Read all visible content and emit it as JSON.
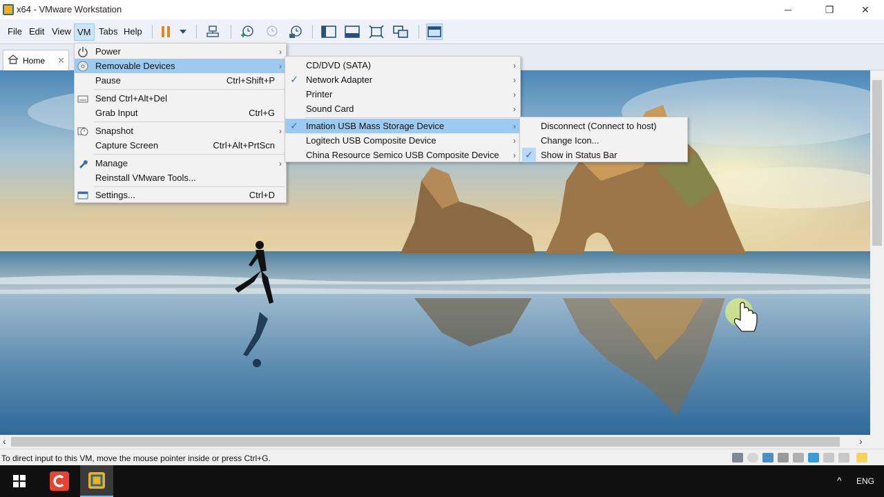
{
  "window": {
    "title": "x64 - VMware Workstation",
    "minimize": "─",
    "maximize": "❐",
    "close": "✕"
  },
  "menubar": {
    "items": [
      "File",
      "Edit",
      "View",
      "VM",
      "Tabs",
      "Help"
    ]
  },
  "tabs": {
    "home_label": "Home",
    "home_close": "✕"
  },
  "vm_menu": {
    "power": "Power",
    "removable": "Removable Devices",
    "pause": "Pause",
    "pause_shortcut": "Ctrl+Shift+P",
    "send_cad": "Send Ctrl+Alt+Del",
    "grab_input": "Grab Input",
    "grab_shortcut": "Ctrl+G",
    "snapshot": "Snapshot",
    "capture": "Capture Screen",
    "capture_shortcut": "Ctrl+Alt+PrtScn",
    "manage": "Manage",
    "reinstall": "Reinstall VMware Tools...",
    "settings": "Settings...",
    "settings_shortcut": "Ctrl+D"
  },
  "removable_menu": {
    "cd": "CD/DVD (SATA)",
    "network": "Network Adapter",
    "printer": "Printer",
    "sound": "Sound Card",
    "imation": "Imation USB Mass Storage Device",
    "logitech": "Logitech USB Composite Device",
    "china": "China Resource Semico USB Composite Device"
  },
  "usb_menu": {
    "disconnect": "Disconnect (Connect to host)",
    "change_icon": "Change Icon...",
    "show_status": "Show in Status Bar"
  },
  "symbols": {
    "arrow": "›",
    "check": "✓",
    "scroll_left": "‹",
    "scroll_right": "›"
  },
  "status": {
    "message": "To direct input to this VM, move the mouse pointer inside or press Ctrl+G."
  },
  "taskbar": {
    "language": "ENG",
    "tray_up": "^"
  },
  "colors": {
    "menu_highlight": "#9dcaf0",
    "accent": "#1a6fd0",
    "pause_orange": "#e08a1e"
  }
}
